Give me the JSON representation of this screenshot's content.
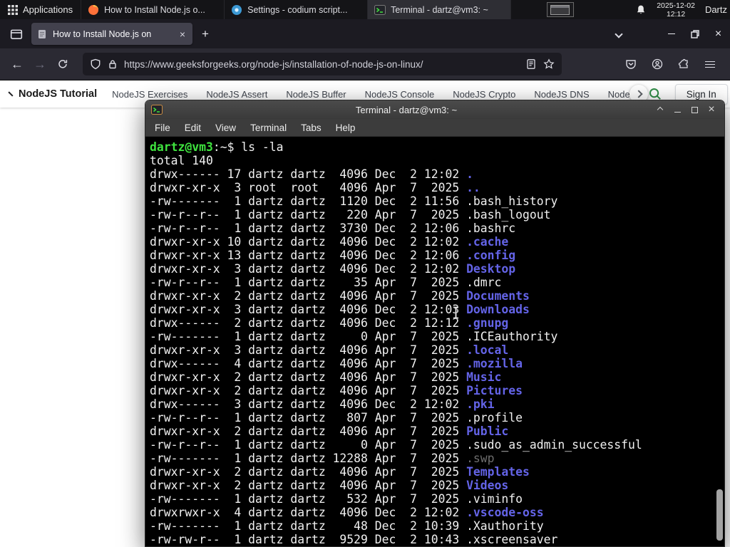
{
  "panel": {
    "applications_label": "Applications",
    "tasks": [
      {
        "title": "How to Install Node.js o...",
        "icon": "firefox"
      },
      {
        "title": "Settings - codium script...",
        "icon": "codium-settings"
      },
      {
        "title": "Terminal - dartz@vm3: ~",
        "icon": "terminal"
      }
    ],
    "clock": {
      "date": "2025-12-02",
      "time": "12:12"
    },
    "user_label": "Dartz"
  },
  "browser": {
    "tab": {
      "title": "How to Install Node.js on",
      "close_glyph": "×"
    },
    "new_tab_glyph": "+",
    "url": "https://www.geeksforgeeks.org/node-js/installation-of-node-js-on-linux/",
    "window_controls": {
      "close": "×"
    }
  },
  "site_nav": {
    "title": "NodeJS Tutorial",
    "items": [
      "NodeJS Exercises",
      "NodeJS Assert",
      "NodeJS Buffer",
      "NodeJS Console",
      "NodeJS Crypto",
      "NodeJS DNS",
      "Node"
    ],
    "sign_in_label": "Sign In",
    "accent_green": "#2f8d46"
  },
  "terminal": {
    "window_title": "Terminal - dartz@vm3: ~",
    "menu": [
      "File",
      "Edit",
      "View",
      "Terminal",
      "Tabs",
      "Help"
    ],
    "window_controls": {
      "close": "×"
    },
    "prompt": {
      "user_host": "dartz@vm3",
      "separator": ":",
      "path": "~",
      "symbol": "$",
      "command": "ls -la"
    },
    "total_line": "total 140",
    "colors": {
      "background": "#000000",
      "foreground": "#f0f0f0",
      "prompt_green": "#3fe43f",
      "directory_blue": "#6464e8",
      "dim_gray": "#6e6e6e"
    },
    "listing": [
      {
        "perm": "drwx------",
        "links": "17",
        "owner": "dartz",
        "group": "dartz",
        "size": "4096",
        "date": "Dec  2 12:02",
        "name": ".",
        "kind": "dir"
      },
      {
        "perm": "drwxr-xr-x",
        "links": "3",
        "owner": "root",
        "group": "root",
        "size": "4096",
        "date": "Apr  7  2025",
        "name": "..",
        "kind": "dir"
      },
      {
        "perm": "-rw-------",
        "links": "1",
        "owner": "dartz",
        "group": "dartz",
        "size": "1120",
        "date": "Dec  2 11:56",
        "name": ".bash_history",
        "kind": "file"
      },
      {
        "perm": "-rw-r--r--",
        "links": "1",
        "owner": "dartz",
        "group": "dartz",
        "size": "220",
        "date": "Apr  7  2025",
        "name": ".bash_logout",
        "kind": "file"
      },
      {
        "perm": "-rw-r--r--",
        "links": "1",
        "owner": "dartz",
        "group": "dartz",
        "size": "3730",
        "date": "Dec  2 12:06",
        "name": ".bashrc",
        "kind": "file"
      },
      {
        "perm": "drwxr-xr-x",
        "links": "10",
        "owner": "dartz",
        "group": "dartz",
        "size": "4096",
        "date": "Dec  2 12:02",
        "name": ".cache",
        "kind": "dir"
      },
      {
        "perm": "drwxr-xr-x",
        "links": "13",
        "owner": "dartz",
        "group": "dartz",
        "size": "4096",
        "date": "Dec  2 12:06",
        "name": ".config",
        "kind": "dir"
      },
      {
        "perm": "drwxr-xr-x",
        "links": "3",
        "owner": "dartz",
        "group": "dartz",
        "size": "4096",
        "date": "Dec  2 12:02",
        "name": "Desktop",
        "kind": "dir"
      },
      {
        "perm": "-rw-r--r--",
        "links": "1",
        "owner": "dartz",
        "group": "dartz",
        "size": "35",
        "date": "Apr  7  2025",
        "name": ".dmrc",
        "kind": "file"
      },
      {
        "perm": "drwxr-xr-x",
        "links": "2",
        "owner": "dartz",
        "group": "dartz",
        "size": "4096",
        "date": "Apr  7  2025",
        "name": "Documents",
        "kind": "dir"
      },
      {
        "perm": "drwxr-xr-x",
        "links": "3",
        "owner": "dartz",
        "group": "dartz",
        "size": "4096",
        "date": "Dec  2 12:03",
        "name": "Downloads",
        "kind": "dir"
      },
      {
        "perm": "drwx------",
        "links": "2",
        "owner": "dartz",
        "group": "dartz",
        "size": "4096",
        "date": "Dec  2 12:12",
        "name": ".gnupg",
        "kind": "dir"
      },
      {
        "perm": "-rw-------",
        "links": "1",
        "owner": "dartz",
        "group": "dartz",
        "size": "0",
        "date": "Apr  7  2025",
        "name": ".ICEauthority",
        "kind": "file"
      },
      {
        "perm": "drwxr-xr-x",
        "links": "3",
        "owner": "dartz",
        "group": "dartz",
        "size": "4096",
        "date": "Apr  7  2025",
        "name": ".local",
        "kind": "dir"
      },
      {
        "perm": "drwx------",
        "links": "4",
        "owner": "dartz",
        "group": "dartz",
        "size": "4096",
        "date": "Apr  7  2025",
        "name": ".mozilla",
        "kind": "dir"
      },
      {
        "perm": "drwxr-xr-x",
        "links": "2",
        "owner": "dartz",
        "group": "dartz",
        "size": "4096",
        "date": "Apr  7  2025",
        "name": "Music",
        "kind": "dir"
      },
      {
        "perm": "drwxr-xr-x",
        "links": "2",
        "owner": "dartz",
        "group": "dartz",
        "size": "4096",
        "date": "Apr  7  2025",
        "name": "Pictures",
        "kind": "dir"
      },
      {
        "perm": "drwx------",
        "links": "3",
        "owner": "dartz",
        "group": "dartz",
        "size": "4096",
        "date": "Dec  2 12:02",
        "name": ".pki",
        "kind": "dir"
      },
      {
        "perm": "-rw-r--r--",
        "links": "1",
        "owner": "dartz",
        "group": "dartz",
        "size": "807",
        "date": "Apr  7  2025",
        "name": ".profile",
        "kind": "file"
      },
      {
        "perm": "drwxr-xr-x",
        "links": "2",
        "owner": "dartz",
        "group": "dartz",
        "size": "4096",
        "date": "Apr  7  2025",
        "name": "Public",
        "kind": "dir"
      },
      {
        "perm": "-rw-r--r--",
        "links": "1",
        "owner": "dartz",
        "group": "dartz",
        "size": "0",
        "date": "Apr  7  2025",
        "name": ".sudo_as_admin_successful",
        "kind": "file"
      },
      {
        "perm": "-rw-------",
        "links": "1",
        "owner": "dartz",
        "group": "dartz",
        "size": "12288",
        "date": "Apr  7  2025",
        "name": ".swp",
        "kind": "dim"
      },
      {
        "perm": "drwxr-xr-x",
        "links": "2",
        "owner": "dartz",
        "group": "dartz",
        "size": "4096",
        "date": "Apr  7  2025",
        "name": "Templates",
        "kind": "dir"
      },
      {
        "perm": "drwxr-xr-x",
        "links": "2",
        "owner": "dartz",
        "group": "dartz",
        "size": "4096",
        "date": "Apr  7  2025",
        "name": "Videos",
        "kind": "dir"
      },
      {
        "perm": "-rw-------",
        "links": "1",
        "owner": "dartz",
        "group": "dartz",
        "size": "532",
        "date": "Apr  7  2025",
        "name": ".viminfo",
        "kind": "file"
      },
      {
        "perm": "drwxrwxr-x",
        "links": "4",
        "owner": "dartz",
        "group": "dartz",
        "size": "4096",
        "date": "Dec  2 12:02",
        "name": ".vscode-oss",
        "kind": "dir"
      },
      {
        "perm": "-rw-------",
        "links": "1",
        "owner": "dartz",
        "group": "dartz",
        "size": "48",
        "date": "Dec  2 10:39",
        "name": ".Xauthority",
        "kind": "file"
      },
      {
        "perm": "-rw-rw-r--",
        "links": "1",
        "owner": "dartz",
        "group": "dartz",
        "size": "9529",
        "date": "Dec  2 10:43",
        "name": ".xscreensaver",
        "kind": "file"
      }
    ]
  }
}
